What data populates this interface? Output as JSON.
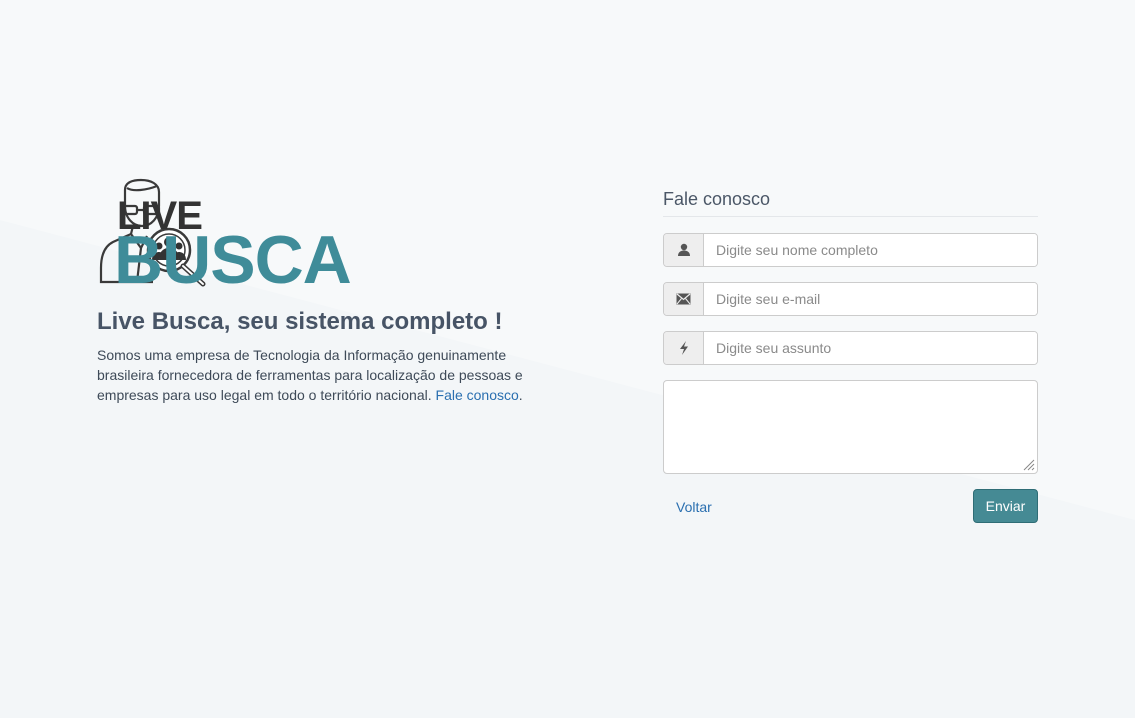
{
  "brand": {
    "logo_line1": "LIVE",
    "logo_line2": "BUSCA",
    "accent_color": "#3f8c99",
    "logo_icon": "person-search-icon"
  },
  "intro": {
    "headline": "Live Busca, seu sistema completo !",
    "description": "Somos uma empresa de Tecnologia da Informação genuinamente brasileira fornecedora de ferramentas para localização de pessoas e empresas para uso legal em todo o território nacional. ",
    "contact_link": "Fale conosco",
    "trailing": "."
  },
  "form": {
    "title": "Fale conosco",
    "fields": [
      {
        "icon": "user-icon",
        "placeholder": "Digite seu nome completo",
        "value": ""
      },
      {
        "icon": "envelope-icon",
        "placeholder": "Digite seu e-mail",
        "value": ""
      },
      {
        "icon": "flash-icon",
        "placeholder": "Digite seu assunto",
        "value": ""
      }
    ],
    "message": {
      "value": ""
    },
    "back_label": "Voltar",
    "submit_label": "Enviar",
    "button_color": "#458a94"
  }
}
